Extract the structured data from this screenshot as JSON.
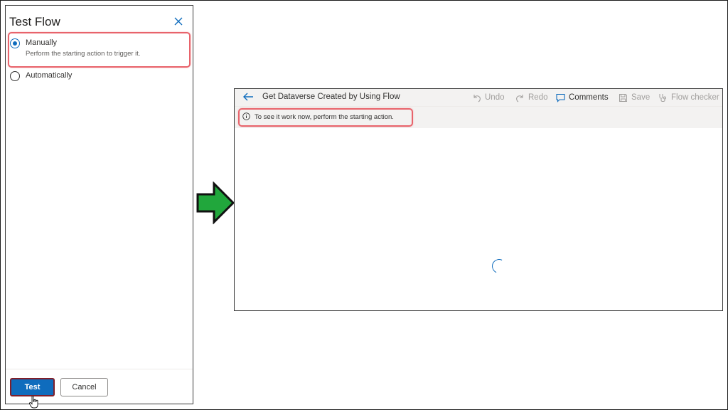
{
  "panel": {
    "title": "Test Flow",
    "options": [
      {
        "label": "Manually",
        "description": "Perform the starting action to trigger it.",
        "selected": true
      },
      {
        "label": "Automatically",
        "selected": false
      }
    ],
    "test_label": "Test",
    "cancel_label": "Cancel"
  },
  "editor": {
    "flow_title": "Get Dataverse Created by Using Flow",
    "toolbar": {
      "undo": "Undo",
      "redo": "Redo",
      "comments": "Comments",
      "save": "Save",
      "flow_checker": "Flow checker"
    },
    "notice": "To see it work now, perform the starting action."
  },
  "colors": {
    "accent": "#0f6cbd",
    "highlight": "#e8636b",
    "arrow_fill": "#21a73c"
  }
}
